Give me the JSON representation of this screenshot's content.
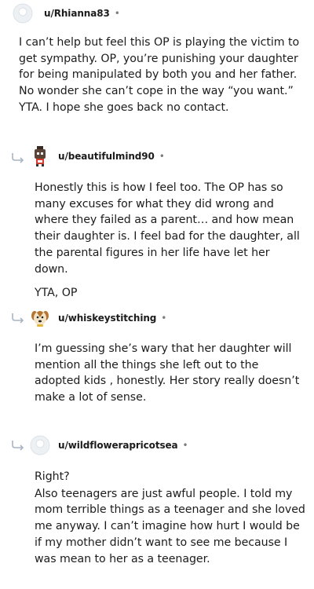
{
  "comments": [
    {
      "username": "u/Rhianna83",
      "avatar_icon": "default-avatar-icon",
      "paragraphs": [
        "I can’t help but feel this OP is playing the victim to get sympathy. OP, you’re punishing your daughter for being manipulated by both you and her father. No wonder she can’t cope in the way “you want.” YTA. I hope she goes back no contact."
      ]
    },
    {
      "username": "u/beautifulmind90",
      "avatar_icon": "robot-avatar-icon",
      "paragraphs": [
        "Honestly this is how I feel too. The OP has so many excuses for what they did wrong and where they failed as a parent… and how mean their daughter is. I feel bad for the daughter, all the parental figures in her life have let her down.",
        "YTA, OP"
      ]
    },
    {
      "username": "u/whiskeystitching",
      "avatar_icon": "dog-avatar-icon",
      "paragraphs": [
        "I’m guessing she’s wary that her daughter will mention all the things she left out to the adopted kids , honestly. Her story really doesn’t make a lot of sense."
      ]
    },
    {
      "username": "u/wildflowerapricotsea",
      "avatar_icon": "default-avatar-icon",
      "paragraphs": [
        "Right?",
        "Also teenagers are just awful people. I told my mom terrible things as a teenager and she loved me anyway. I can’t imagine how hurt I would be if my mother didn’t want to see me because I was mean to her as a teenager."
      ]
    }
  ],
  "separator": "•",
  "colors": {
    "text": "#1c1c1c",
    "meta": "#7c7c7c",
    "reply_arrow": "#a8b4c4"
  }
}
